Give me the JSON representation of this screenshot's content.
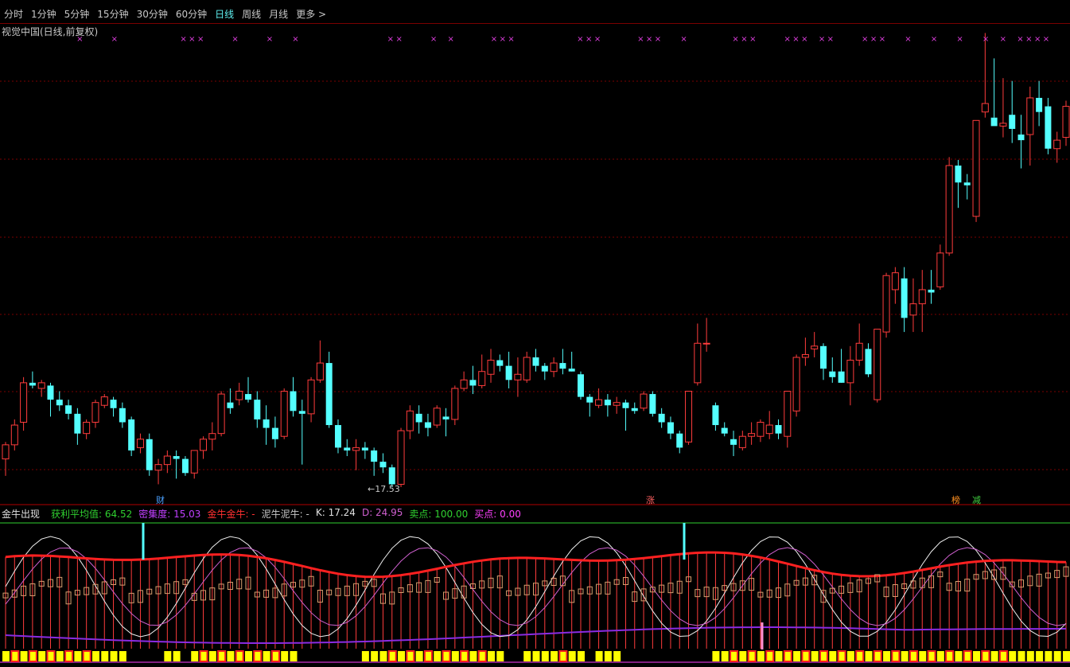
{
  "toolbar": {
    "items": [
      "分时",
      "1分钟",
      "5分钟",
      "15分钟",
      "30分钟",
      "60分钟",
      "日线",
      "周线",
      "月线",
      "更多 >"
    ],
    "active_index": 6
  },
  "main_chart": {
    "title": "视觉中国(日线,前复权)",
    "low_label": "←17.53",
    "markers": [
      {
        "label": "财",
        "color": "#4aa0ff"
      },
      {
        "label": "涨",
        "color": "#ff6060"
      },
      {
        "label": "榜",
        "color": "#ff9020"
      },
      {
        "label": "减",
        "color": "#40d040"
      }
    ]
  },
  "indicator": {
    "name": "金牛出现",
    "fields": [
      {
        "label": "获利平均值: 64.52",
        "color": "#30d030"
      },
      {
        "label": "密集度: 15.03",
        "color": "#c040ff"
      },
      {
        "label": "金牛金牛: -",
        "color": "#ff3030"
      },
      {
        "label": "泥牛泥牛: -",
        "color": "#c8c8c8"
      },
      {
        "label": "K: 17.24",
        "color": "#e0e0e0"
      },
      {
        "label": "D: 24.95",
        "color": "#d060d0"
      },
      {
        "label": "卖点: 100.00",
        "color": "#30d030"
      },
      {
        "label": "买点: 0.00",
        "color": "#ff40ff"
      }
    ]
  },
  "colors": {
    "up": "#ff3c3c",
    "down": "#54ffff",
    "grid": "#7a0000",
    "magenta_x": "#e040e0"
  },
  "chart_data": {
    "type": "candlestick",
    "series": [
      {
        "name": "ohlc",
        "values": [
          [
            16.5,
            17.1,
            15.9,
            17.0
          ],
          [
            17.0,
            17.9,
            16.8,
            17.7
          ],
          [
            17.8,
            19.4,
            17.5,
            19.2
          ],
          [
            19.2,
            19.6,
            19.0,
            19.1
          ],
          [
            19.0,
            19.3,
            18.7,
            19.2
          ],
          [
            19.1,
            19.2,
            18.0,
            18.6
          ],
          [
            18.6,
            18.9,
            18.2,
            18.4
          ],
          [
            18.4,
            18.6,
            17.9,
            18.1
          ],
          [
            18.1,
            18.3,
            17.0,
            17.4
          ],
          [
            17.4,
            17.9,
            17.2,
            17.8
          ],
          [
            17.8,
            18.6,
            17.6,
            18.5
          ],
          [
            18.4,
            18.8,
            18.3,
            18.7
          ],
          [
            18.6,
            18.7,
            18.0,
            18.3
          ],
          [
            18.3,
            18.5,
            17.6,
            17.8
          ],
          [
            17.9,
            18.0,
            16.6,
            16.8
          ],
          [
            16.9,
            17.4,
            16.7,
            17.2
          ],
          [
            17.2,
            17.4,
            15.9,
            16.1
          ],
          [
            16.1,
            16.5,
            15.6,
            16.3
          ],
          [
            16.3,
            16.8,
            16.0,
            16.6
          ],
          [
            16.6,
            16.8,
            15.8,
            16.5
          ],
          [
            16.5,
            16.6,
            15.9,
            16.0
          ],
          [
            16.0,
            16.8,
            15.8,
            16.8
          ],
          [
            16.8,
            17.3,
            16.5,
            17.2
          ],
          [
            17.2,
            17.8,
            16.8,
            17.4
          ],
          [
            17.4,
            18.9,
            17.3,
            18.8
          ],
          [
            18.5,
            19.0,
            18.1,
            18.3
          ],
          [
            18.6,
            19.2,
            18.4,
            18.9
          ],
          [
            18.8,
            19.4,
            18.5,
            18.6
          ],
          [
            18.6,
            18.9,
            17.6,
            17.9
          ],
          [
            17.9,
            18.4,
            17.0,
            17.6
          ],
          [
            17.6,
            18.0,
            16.9,
            17.2
          ],
          [
            17.3,
            19.0,
            17.2,
            18.9
          ],
          [
            18.9,
            19.4,
            18.0,
            18.2
          ],
          [
            18.2,
            18.6,
            16.3,
            18.1
          ],
          [
            18.1,
            19.4,
            17.8,
            19.3
          ],
          [
            19.3,
            20.7,
            19.2,
            19.9
          ],
          [
            19.9,
            20.3,
            17.6,
            17.7
          ],
          [
            17.7,
            17.9,
            16.7,
            16.9
          ],
          [
            16.9,
            17.2,
            16.6,
            16.8
          ],
          [
            16.8,
            17.2,
            16.1,
            16.9
          ],
          [
            16.9,
            17.1,
            16.5,
            16.8
          ],
          [
            16.8,
            16.9,
            15.9,
            16.4
          ],
          [
            16.4,
            16.7,
            16.0,
            16.2
          ],
          [
            16.2,
            16.3,
            15.5,
            15.6
          ],
          [
            15.6,
            17.6,
            15.5,
            17.5
          ],
          [
            17.5,
            18.4,
            17.2,
            18.2
          ],
          [
            18.1,
            18.4,
            17.4,
            17.8
          ],
          [
            17.8,
            18.1,
            17.3,
            17.6
          ],
          [
            17.7,
            18.4,
            17.6,
            18.3
          ],
          [
            18.0,
            18.3,
            17.3,
            17.9
          ],
          [
            17.9,
            19.1,
            17.7,
            19.0
          ],
          [
            19.0,
            19.6,
            18.9,
            19.3
          ],
          [
            19.3,
            19.8,
            18.8,
            19.1
          ],
          [
            19.1,
            20.2,
            19.0,
            19.6
          ],
          [
            19.5,
            20.4,
            19.2,
            20.0
          ],
          [
            20.0,
            20.2,
            19.6,
            19.8
          ],
          [
            19.8,
            20.3,
            19.0,
            19.3
          ],
          [
            19.3,
            20.1,
            18.7,
            19.5
          ],
          [
            19.3,
            20.3,
            19.2,
            20.1
          ],
          [
            20.1,
            20.4,
            19.6,
            19.8
          ],
          [
            19.8,
            19.9,
            19.3,
            19.6
          ],
          [
            19.6,
            20.1,
            19.4,
            19.9
          ],
          [
            19.9,
            20.4,
            19.5,
            19.7
          ],
          [
            19.7,
            20.3,
            19.6,
            19.6
          ],
          [
            19.5,
            19.6,
            18.6,
            18.7
          ],
          [
            18.7,
            18.8,
            18.0,
            18.5
          ],
          [
            18.4,
            19.0,
            18.3,
            18.6
          ],
          [
            18.6,
            18.8,
            18.0,
            18.4
          ],
          [
            18.4,
            18.7,
            18.1,
            18.5
          ],
          [
            18.5,
            18.6,
            17.5,
            18.3
          ],
          [
            18.3,
            18.5,
            18.1,
            18.2
          ],
          [
            18.3,
            18.9,
            18.2,
            18.8
          ],
          [
            18.8,
            18.9,
            18.0,
            18.1
          ],
          [
            18.1,
            18.3,
            17.6,
            17.8
          ],
          [
            17.8,
            18.0,
            17.2,
            17.4
          ],
          [
            17.4,
            17.5,
            16.7,
            16.9
          ],
          [
            17.1,
            18.9,
            17.0,
            18.9
          ],
          [
            19.2,
            21.3,
            19.1,
            20.6
          ],
          [
            20.6,
            21.5,
            20.3,
            20.6
          ],
          [
            18.4,
            18.5,
            17.5,
            17.7
          ],
          [
            17.6,
            17.8,
            17.3,
            17.4
          ],
          [
            17.2,
            17.5,
            16.6,
            17.0
          ],
          [
            16.9,
            17.5,
            16.8,
            17.3
          ],
          [
            17.3,
            17.8,
            17.0,
            17.4
          ],
          [
            17.3,
            17.9,
            17.1,
            17.8
          ],
          [
            17.4,
            18.2,
            17.2,
            17.7
          ],
          [
            17.7,
            17.9,
            17.2,
            17.4
          ],
          [
            17.3,
            18.9,
            16.9,
            18.9
          ],
          [
            18.2,
            20.2,
            18.0,
            20.1
          ],
          [
            20.1,
            20.8,
            19.8,
            20.2
          ],
          [
            20.4,
            21.0,
            20.1,
            20.5
          ],
          [
            20.5,
            20.6,
            19.3,
            19.7
          ],
          [
            19.6,
            20.1,
            19.2,
            19.4
          ],
          [
            19.6,
            20.4,
            19.2,
            19.2
          ],
          [
            19.2,
            20.5,
            18.4,
            20.0
          ],
          [
            20.0,
            21.3,
            19.8,
            20.6
          ],
          [
            20.4,
            20.6,
            19.4,
            19.5
          ],
          [
            18.6,
            21.1,
            18.5,
            21.1
          ],
          [
            21.0,
            23.1,
            20.8,
            23.0
          ],
          [
            22.5,
            23.3,
            22.0,
            23.1
          ],
          [
            22.9,
            23.3,
            21.0,
            21.5
          ],
          [
            21.6,
            22.9,
            21.0,
            22.0
          ],
          [
            22.0,
            23.2,
            21.0,
            22.5
          ],
          [
            22.5,
            23.2,
            22.0,
            22.4
          ],
          [
            22.6,
            24.1,
            22.5,
            23.8
          ],
          [
            23.8,
            27.2,
            23.7,
            26.9
          ],
          [
            26.9,
            27.1,
            25.4,
            26.3
          ],
          [
            26.3,
            26.6,
            25.7,
            26.2
          ],
          [
            25.1,
            28.3,
            24.9,
            28.5
          ],
          [
            28.8,
            31.6,
            28.6,
            29.1
          ],
          [
            28.6,
            30.7,
            28.6,
            28.3
          ],
          [
            28.3,
            30.0,
            27.9,
            28.4
          ],
          [
            28.7,
            29.9,
            27.7,
            28.2
          ],
          [
            28.0,
            28.7,
            26.8,
            27.8
          ],
          [
            28.0,
            29.7,
            26.9,
            29.3
          ],
          [
            29.3,
            29.9,
            28.3,
            28.8
          ],
          [
            29.0,
            29.3,
            27.3,
            27.5
          ],
          [
            27.5,
            28.1,
            27.0,
            27.8
          ],
          [
            27.9,
            29.2,
            27.6,
            29.0
          ]
        ]
      }
    ],
    "y_axis": {
      "min": 15.5,
      "max": 31.5
    },
    "k_value": 17.24,
    "d_value": 24.95
  }
}
